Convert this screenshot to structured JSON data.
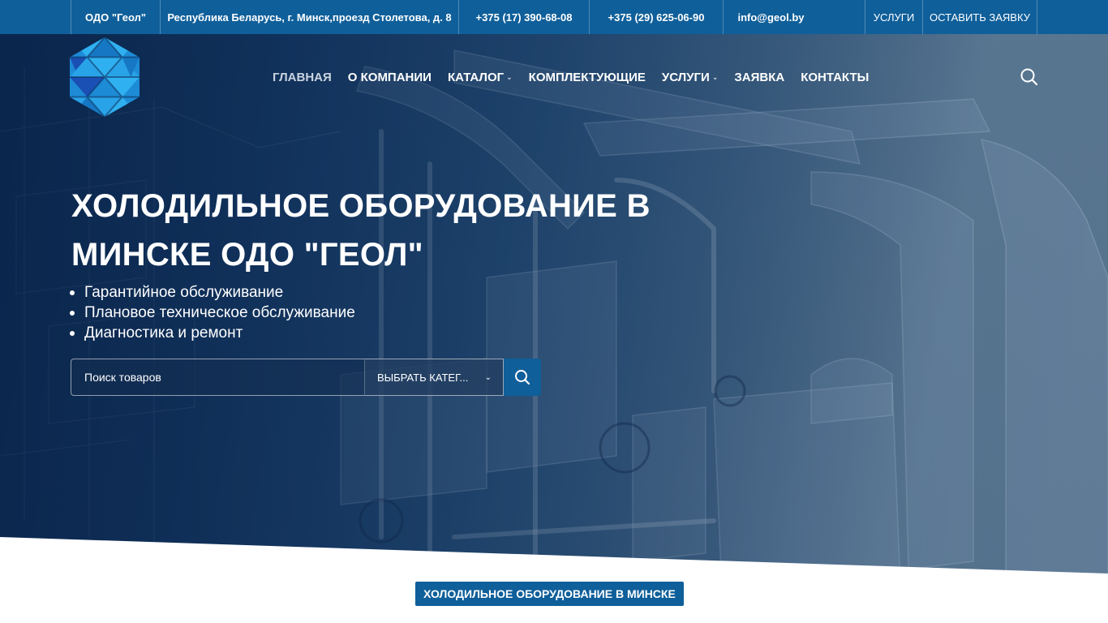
{
  "topbar": {
    "company": "ОДО \"Геол\"",
    "address": "Республика Беларусь, г. Минск,проезд Столетова, д. 8",
    "phone1": "+375 (17) 390-68-08",
    "phone2": "+375 (29) 625-06-90",
    "email": "info@geol.by",
    "services": "УСЛУГИ",
    "request": "ОСТАВИТЬ ЗАЯВКУ"
  },
  "nav": {
    "items": [
      {
        "label": "ГЛАВНАЯ",
        "active": true
      },
      {
        "label": "О КОМПАНИИ"
      },
      {
        "label": "КАТАЛОГ",
        "dropdown": true
      },
      {
        "label": "КОМПЛЕКТУЮЩИЕ"
      },
      {
        "label": "УСЛУГИ",
        "dropdown": true
      },
      {
        "label": "ЗАЯВКА"
      },
      {
        "label": "КОНТАКТЫ"
      }
    ],
    "search_icon": "search-icon"
  },
  "hero": {
    "title": "ХОЛОДИЛЬНОЕ ОБОРУДОВАНИЕ В МИНСКЕ ОДО \"ГЕОЛ\"",
    "bullets": [
      "Гарантийное обслуживание",
      "Плановое техническое обслуживание",
      "Диагностика и ремонт"
    ],
    "search": {
      "placeholder": "Поиск товаров",
      "value": "",
      "category": "ВЫБРАТЬ КАТЕГ...",
      "button_icon": "search-icon"
    }
  },
  "section": {
    "badge": "ХОЛОДИЛЬНОЕ ОБОРУДОВАНИЕ В МИНСКЕ"
  },
  "colors": {
    "brand_blue": "#0f5f9a",
    "hero_dark": "#0d2d57",
    "logo_light": "#29a3e8",
    "logo_dark": "#1a4fb4"
  }
}
